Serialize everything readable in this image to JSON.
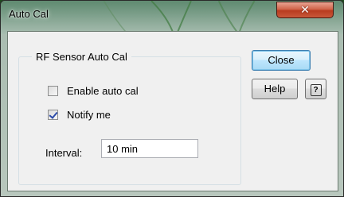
{
  "window": {
    "title": "Auto Cal",
    "close_glyph": "✕"
  },
  "group": {
    "title": "RF Sensor Auto Cal",
    "enable_auto_cal": {
      "label": "Enable auto cal",
      "checked": false
    },
    "notify_me": {
      "label": "Notify me",
      "checked": true
    },
    "interval": {
      "label": "Interval:",
      "value": "10 min"
    }
  },
  "buttons": {
    "close_label": "Close",
    "help_label": "Help",
    "context_help_icon": "context-help-icon",
    "context_help_glyph": "?"
  }
}
